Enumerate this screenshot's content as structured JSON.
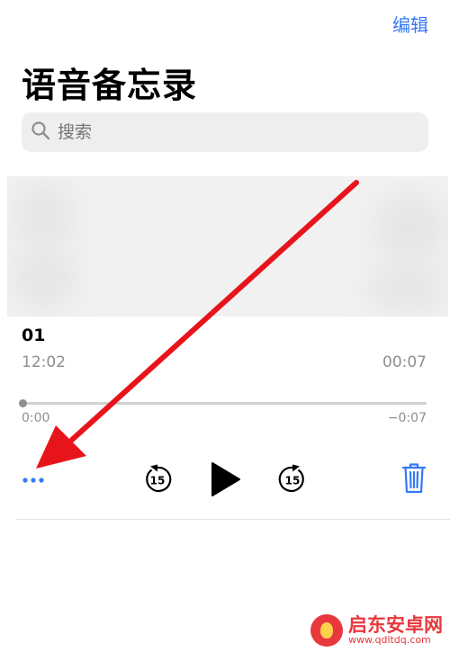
{
  "colors": {
    "accent": "#3478f6",
    "secondary_text": "#8e8e93",
    "search_bg": "#eeeeef",
    "track": "#d1d1d6",
    "divider": "#e3e3e6",
    "arrow": "#e8141c",
    "watermark": "#e8383d"
  },
  "header": {
    "edit_label": "编辑",
    "title": "语音备忘录"
  },
  "search": {
    "placeholder": "搜索",
    "value": ""
  },
  "recording": {
    "name": "01",
    "date": "12:02",
    "duration": "00:07",
    "elapsed": "0:00",
    "remaining": "−0:07",
    "progress": 0
  },
  "controls": {
    "more_icon": "ellipsis-icon",
    "skip_back_icon": "skip-back-15-icon",
    "skip_back_label": "15",
    "play_icon": "play-icon",
    "skip_forward_icon": "skip-forward-15-icon",
    "skip_forward_label": "15",
    "delete_icon": "trash-icon"
  },
  "watermark": {
    "title": "启东安卓网",
    "url": "www.qdltdq.com"
  }
}
